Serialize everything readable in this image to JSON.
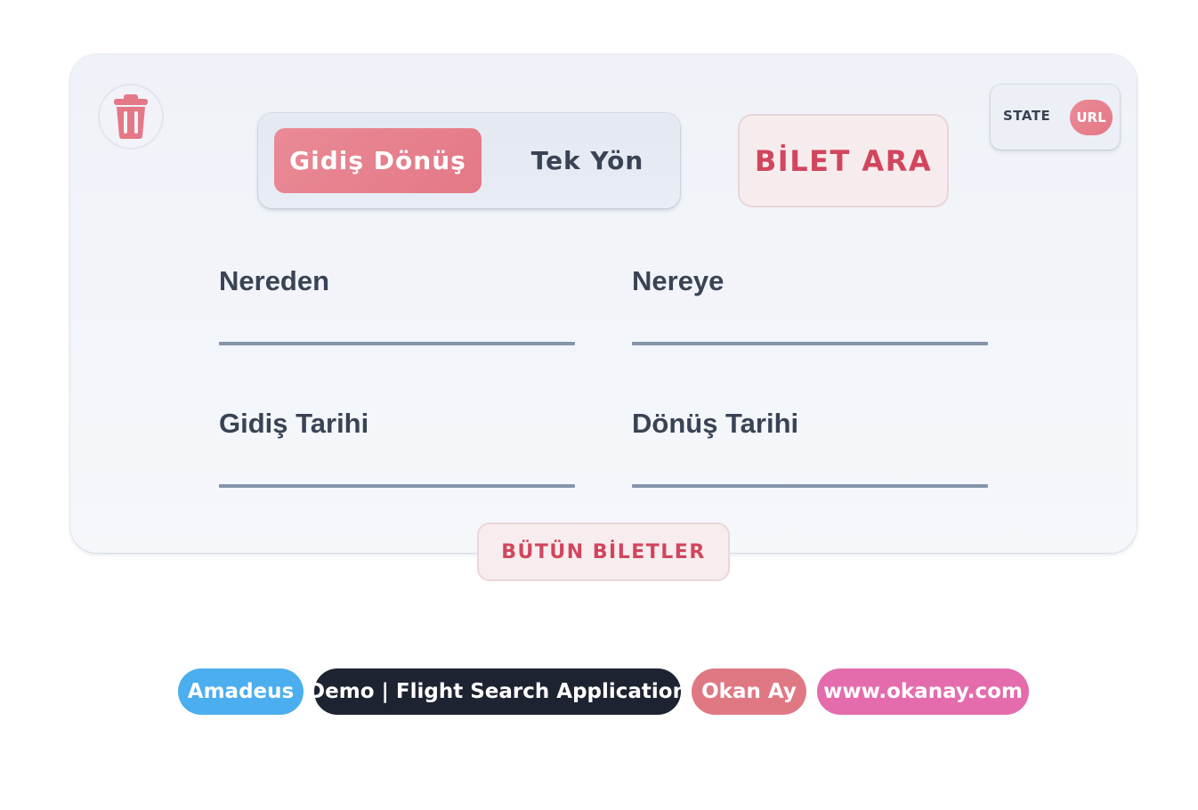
{
  "trip_type": {
    "options": [
      "Gidiş Dönüş",
      "Tek Yön"
    ],
    "selected": "Gidiş Dönüş"
  },
  "search_button": "BİLET ARA",
  "mode_switch": {
    "state_label": "STATE",
    "url_label": "URL",
    "selected": "URL"
  },
  "fields": {
    "from": "Nereden",
    "to": "Nereye",
    "departure_date": "Gidiş Tarihi",
    "return_date": "Dönüş Tarihi"
  },
  "all_tickets_button": "BÜTÜN BİLETLER",
  "footer_badges": [
    {
      "label": "Amadeus",
      "color": "#4baeee"
    },
    {
      "label": "Demo | Flight Search Application",
      "color": "#1e2332"
    },
    {
      "label": "Okan Ay",
      "color": "#e07883"
    },
    {
      "label": "www.okanay.com",
      "color": "#e46cad"
    }
  ],
  "icons": {
    "clear": "trash-icon"
  },
  "colors": {
    "accent": "#e47886",
    "accent_text": "#d1465d",
    "text": "#3a4354",
    "underline": "#8594aa"
  }
}
